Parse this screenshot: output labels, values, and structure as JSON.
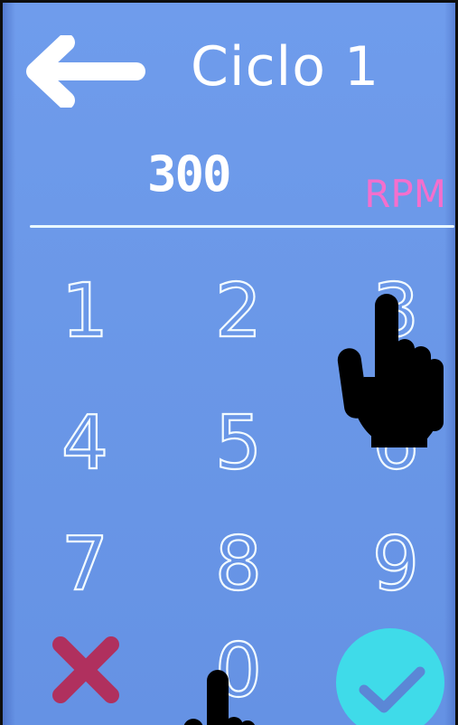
{
  "header": {
    "title": "Ciclo 1",
    "back_icon": "arrow-left-icon"
  },
  "display": {
    "value": "300",
    "unit": "RPM"
  },
  "keypad": {
    "keys": [
      "1",
      "2",
      "3",
      "4",
      "5",
      "6",
      "7",
      "8",
      "9",
      "0"
    ],
    "cancel_icon": "x-icon",
    "confirm_icon": "checkmark-icon"
  },
  "colors": {
    "screen_background": "#6e9bea",
    "text": "#ffffff",
    "unit_accent": "#f46fcd",
    "cancel": "#b0305e",
    "confirm": "#3fdbe9"
  }
}
